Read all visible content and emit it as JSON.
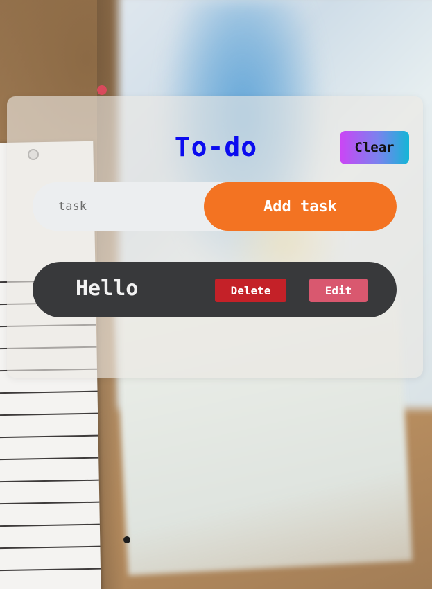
{
  "app": {
    "title": "To-do"
  },
  "toolbar": {
    "clear_label": "Clear"
  },
  "new_task": {
    "value": "",
    "placeholder": "task",
    "add_label": "Add task"
  },
  "tasks": [
    {
      "text": "Hello",
      "delete_label": "Delete",
      "edit_label": "Edit"
    }
  ],
  "colors": {
    "title": "#0b0bef",
    "add_button": "#f37322",
    "delete_button": "#c42128",
    "edit_button": "#d9586f",
    "task_item_bg": "#38393b",
    "clear_gradient_start": "#cc45f5",
    "clear_gradient_end": "#14b6d6"
  }
}
